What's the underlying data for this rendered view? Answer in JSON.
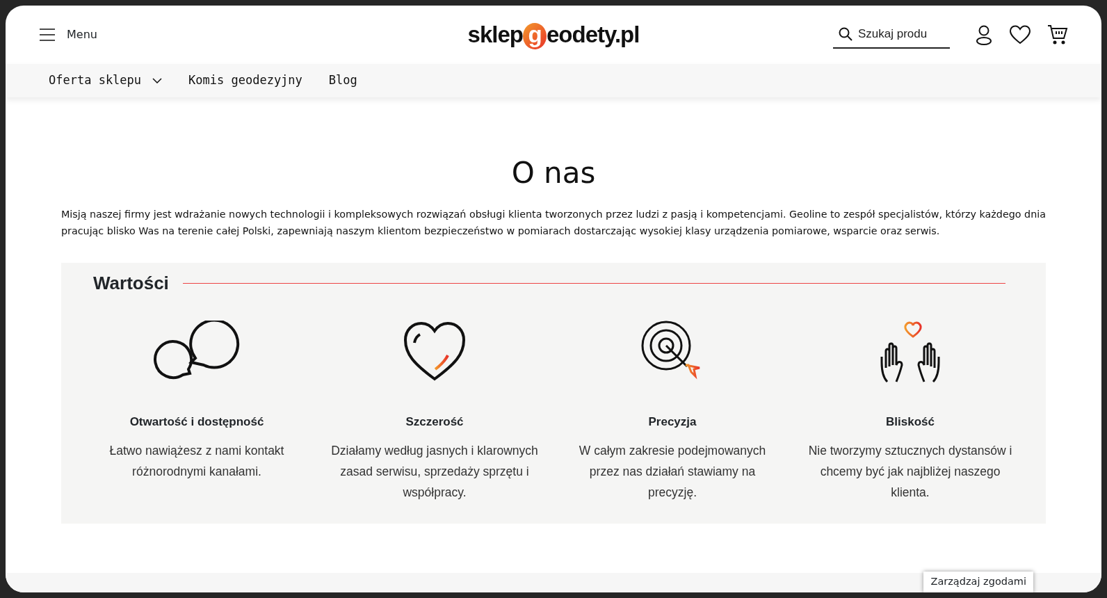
{
  "header": {
    "menu_label": "Menu",
    "logo": {
      "before": "sklep",
      "mark": "g",
      "after": "eodety.pl"
    },
    "search": {
      "placeholder": "Szukaj produ"
    }
  },
  "nav": [
    {
      "label": "Oferta sklepu",
      "dropdown": true
    },
    {
      "label": "Komis geodezyjny",
      "dropdown": false
    },
    {
      "label": "Blog",
      "dropdown": false
    }
  ],
  "page": {
    "title": "O nas",
    "intro": "Misją naszej firmy jest wdrażanie nowych technologii i kompleksowych rozwiązań obsługi klienta tworzonych przez ludzi z pasją i kompetencjami. Geoline to zespół specjalistów, którzy każdego dnia pracując blisko Was na terenie całej Polski, zapewniają naszym klientom bezpieczeństwo w pomiarach dostarczając wysokiej klasy urządzenia pomiarowe, wsparcie oraz serwis."
  },
  "values": {
    "heading": "Wartości",
    "items": [
      {
        "kind": "chat",
        "title": "Otwartość i dostępność",
        "text": "Łatwo nawiążesz z nami kontakt różnorodnymi kanałami."
      },
      {
        "kind": "heart",
        "title": "Szczerość",
        "text": "Działamy według jasnych i klarownych zasad serwisu, sprzedaży sprzętu i współpracy."
      },
      {
        "kind": "target",
        "title": "Precyzja",
        "text": "W całym zakresie podejmowanych przez nas działań stawiamy na precyzję."
      },
      {
        "kind": "hands",
        "title": "Bliskość",
        "text": "Nie tworzymy sztucznych dystansów i chcemy być jak najbliżej naszego klienta."
      }
    ]
  },
  "consent_button": "Zarządzaj zgodami"
}
